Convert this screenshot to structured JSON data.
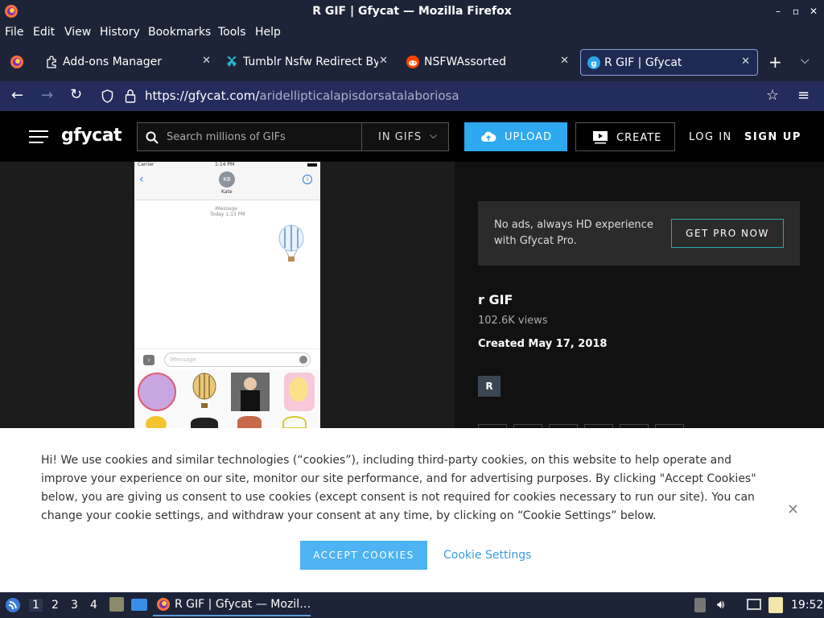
{
  "window": {
    "title": "R GIF | Gfycat — Mozilla Firefox",
    "controls": [
      "–",
      "▫",
      "✕"
    ]
  },
  "menu": [
    "File",
    "Edit",
    "View",
    "History",
    "Bookmarks",
    "Tools",
    "Help"
  ],
  "tabs": [
    {
      "label": "Add-ons Manager",
      "icon": "puzzle-icon"
    },
    {
      "label": "Tumblr Nsfw Redirect Byp",
      "icon": "tumblr-ext-icon"
    },
    {
      "label": "NSFWAssorted",
      "icon": "reddit-icon"
    },
    {
      "label": "R GIF | Gfycat",
      "icon": "gfycat-icon",
      "active": true
    }
  ],
  "nav": {
    "url_domain": "https://gfycat.com/",
    "url_path": "aridellipticalapisdorsatalaboriosa"
  },
  "site": {
    "logo": "gfycat",
    "search_placeholder": "Search millions of GIFs",
    "filter_label": "IN GIFS",
    "upload_label": "UPLOAD",
    "create_label": "CREATE",
    "login_label": "LOG IN",
    "signup_label": "SIGN UP"
  },
  "phone": {
    "carrier": "Carrier",
    "time": "1:14 PM",
    "contact_initials": "KB",
    "contact_name": "Kate",
    "service": "iMessage",
    "timestamp": "Today 1:13 PM",
    "input_placeholder": "iMessage"
  },
  "details": {
    "pro_text": "No ads, always HD experience with Gfycat Pro.",
    "pro_button": "GET PRO NOW",
    "title": "r GIF",
    "views": "102.6K views",
    "created": "Created May 17, 2018",
    "tag": "R"
  },
  "cookie": {
    "text": "Hi! We use cookies and similar technologies (“cookies”), including third-party cookies, on this website to help operate and improve your experience on our site, monitor our site performance, and for advertising purposes. By clicking \"Accept Cookies\" below, you are giving us consent to use cookies (except consent is not required for cookies necessary to run our site). You can change your cookie settings, and withdraw your consent at any time, by clicking on “Cookie Settings” below.",
    "accept_label": "ACCEPT COOKIES",
    "settings_label": "Cookie Settings"
  },
  "taskbar": {
    "workspaces": [
      "1",
      "2",
      "3",
      "4"
    ],
    "task_label": "R GIF | Gfycat — Mozil…",
    "clock": "19:52"
  }
}
